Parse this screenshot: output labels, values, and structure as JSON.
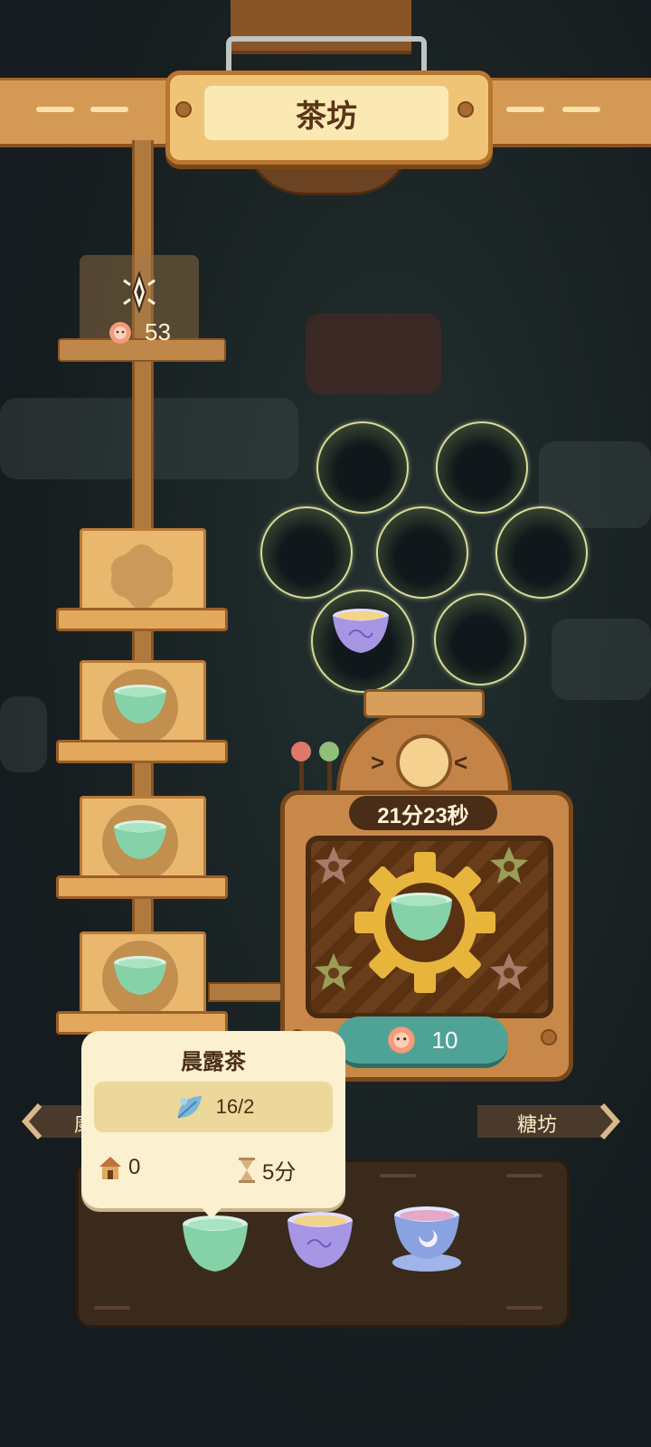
{
  "header": {
    "title": "茶坊"
  },
  "progress": {
    "cost_value": "53",
    "coin_icon": "flower-coin-icon",
    "spark_icon": "sparkle-icon"
  },
  "shelf_items": [
    {
      "state": "locked",
      "icon": "flower-slot-icon"
    },
    {
      "state": "filled",
      "icon": "green-tea-cup-icon"
    },
    {
      "state": "filled",
      "icon": "green-tea-cup-icon"
    },
    {
      "state": "filled",
      "icon": "green-tea-cup-icon"
    }
  ],
  "bubbles": {
    "total_slots": 7,
    "filled_slots": 1,
    "filled_item": "purple-tea-cup-icon"
  },
  "machine": {
    "timer": "21分23秒",
    "current_item": "green-tea-cup-icon",
    "price": "10",
    "price_icon": "flower-coin-icon"
  },
  "navigation": {
    "left_label": "康",
    "right_label": "糖坊"
  },
  "tooltip": {
    "title": "晨露茶",
    "ingredient_count": "16/2",
    "ingredient_icon": "herb-leaf-icon",
    "house_value": "0",
    "house_icon": "hut-icon",
    "time_value": "5分",
    "time_icon": "hourglass-icon"
  },
  "recipes": [
    {
      "icon": "green-tea-cup-icon",
      "selected": true
    },
    {
      "icon": "purple-tea-cup-icon",
      "selected": false
    },
    {
      "icon": "blue-moon-tea-cup-icon",
      "selected": false
    }
  ],
  "colors": {
    "accent_teal": "#4fa396",
    "wood": "#c78849",
    "cream": "#fbf0d0",
    "text_dark": "#4a2d16"
  }
}
